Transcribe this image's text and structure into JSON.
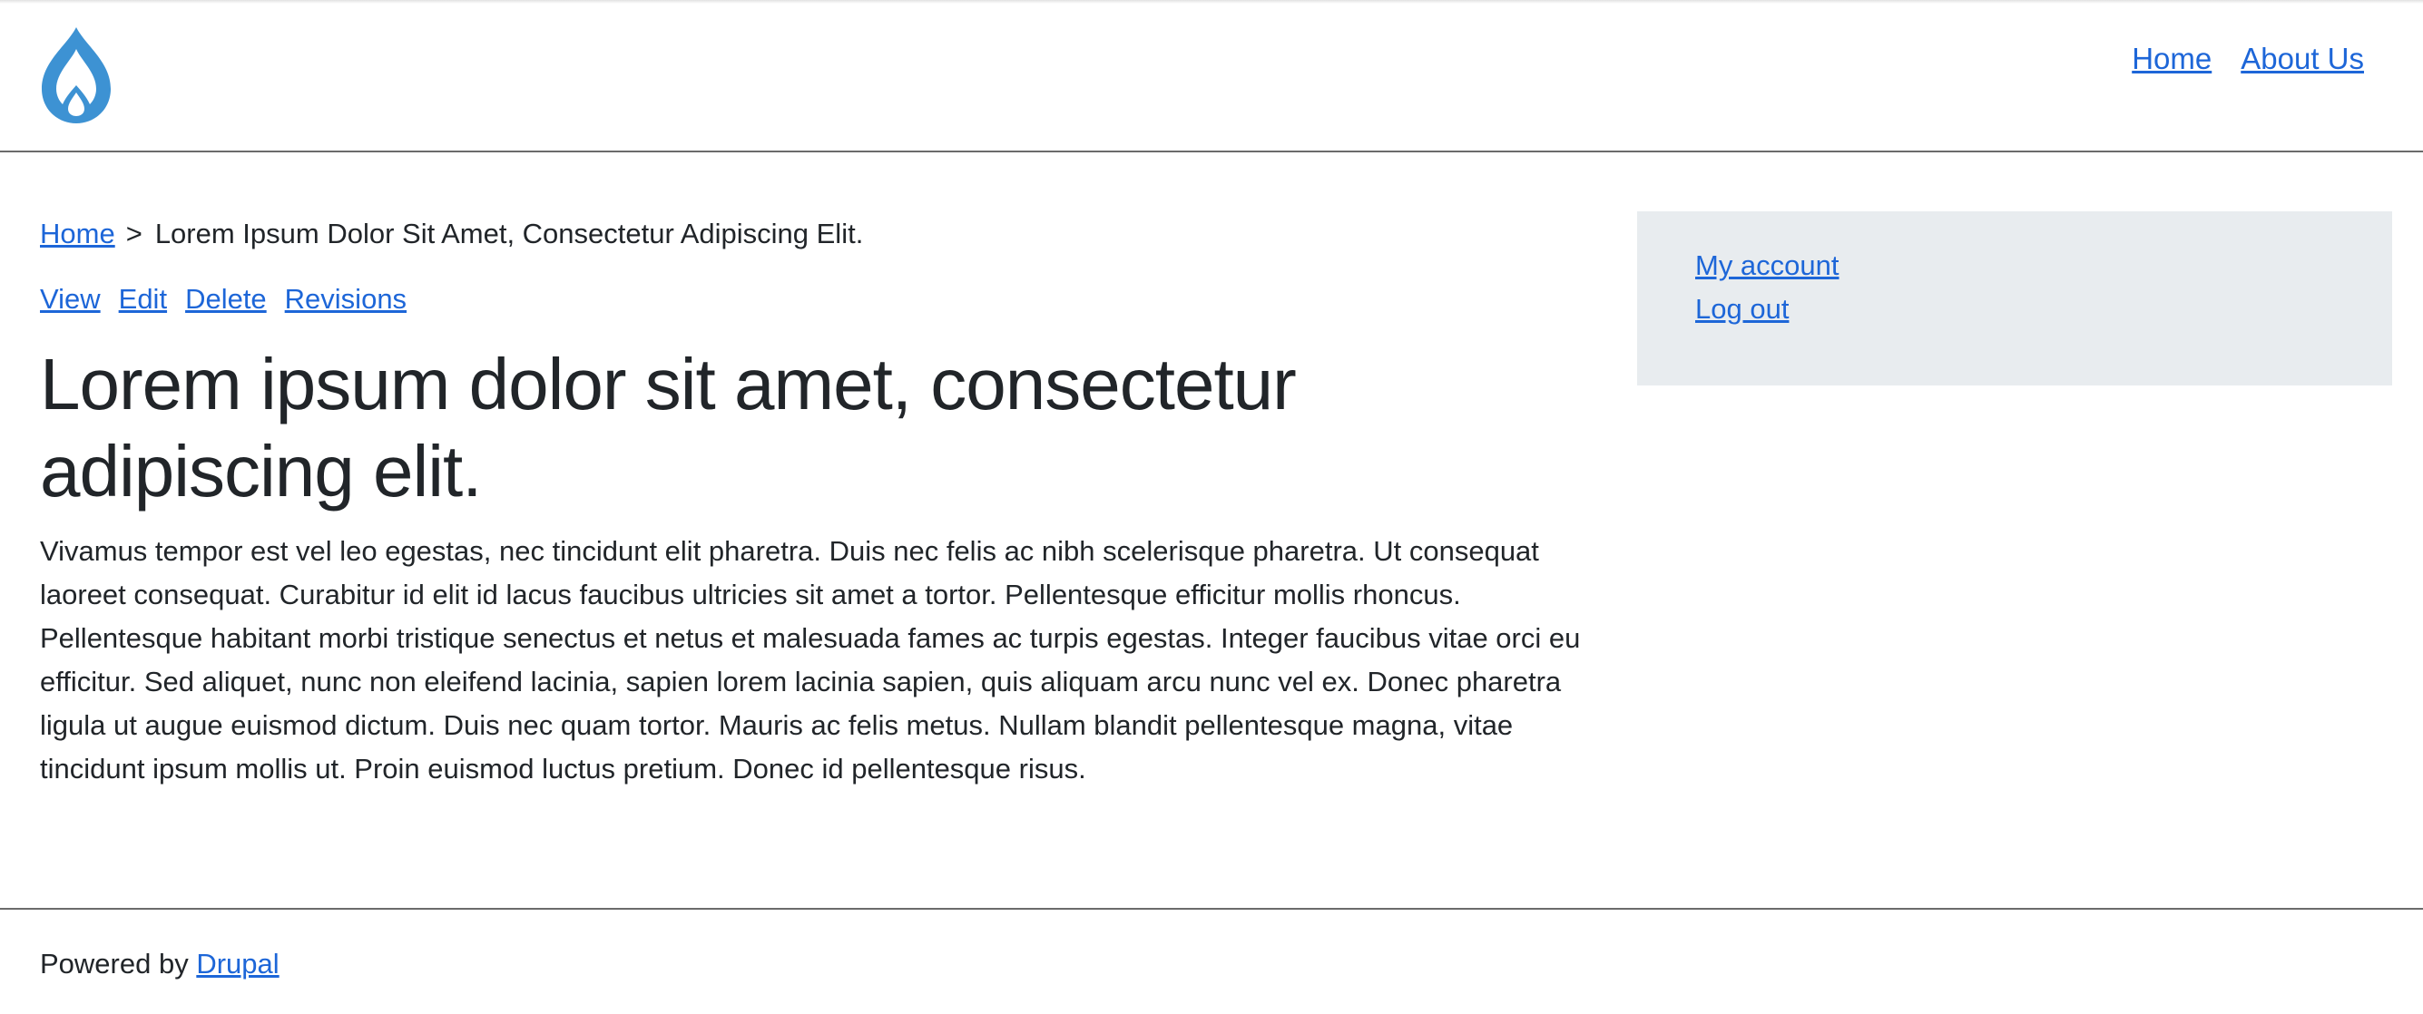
{
  "header": {
    "logo_icon": "drupal-drop-icon",
    "nav": [
      {
        "label": "Home"
      },
      {
        "label": "About Us"
      }
    ]
  },
  "breadcrumb": {
    "home": "Home",
    "separator": ">",
    "current": "Lorem Ipsum Dolor Sit Amet, Consectetur Adipiscing Elit."
  },
  "tabs": [
    {
      "label": "View"
    },
    {
      "label": "Edit"
    },
    {
      "label": "Delete"
    },
    {
      "label": "Revisions"
    }
  ],
  "page": {
    "title": "Lorem ipsum dolor sit amet, consectetur adipiscing elit.",
    "body": "Vivamus tempor est vel leo egestas, nec tincidunt elit pharetra. Duis nec felis ac nibh scelerisque pharetra. Ut consequat laoreet consequat. Curabitur id elit id lacus faucibus ultricies sit amet a tortor. Pellentesque efficitur mollis rhoncus. Pellentesque habitant morbi tristique senectus et netus et malesuada fames ac turpis egestas. Integer faucibus vitae orci eu efficitur. Sed aliquet, nunc non eleifend lacinia, sapien lorem lacinia sapien, quis aliquam arcu nunc vel ex. Donec pharetra ligula ut augue euismod dictum. Duis nec quam tortor. Mauris ac felis metus. Nullam blandit pellentesque magna, vitae tincidunt ipsum mollis ut. Proin euismod luctus pretium. Donec id pellentesque risus."
  },
  "sidebar": {
    "links": [
      {
        "label": "My account"
      },
      {
        "label": "Log out"
      }
    ]
  },
  "footer": {
    "prefix": "Powered by",
    "link": "Drupal"
  },
  "colors": {
    "link": "#1d66d8",
    "text": "#212529",
    "sidebar_bg": "#e8ecef",
    "logo": "#3d92d3"
  }
}
